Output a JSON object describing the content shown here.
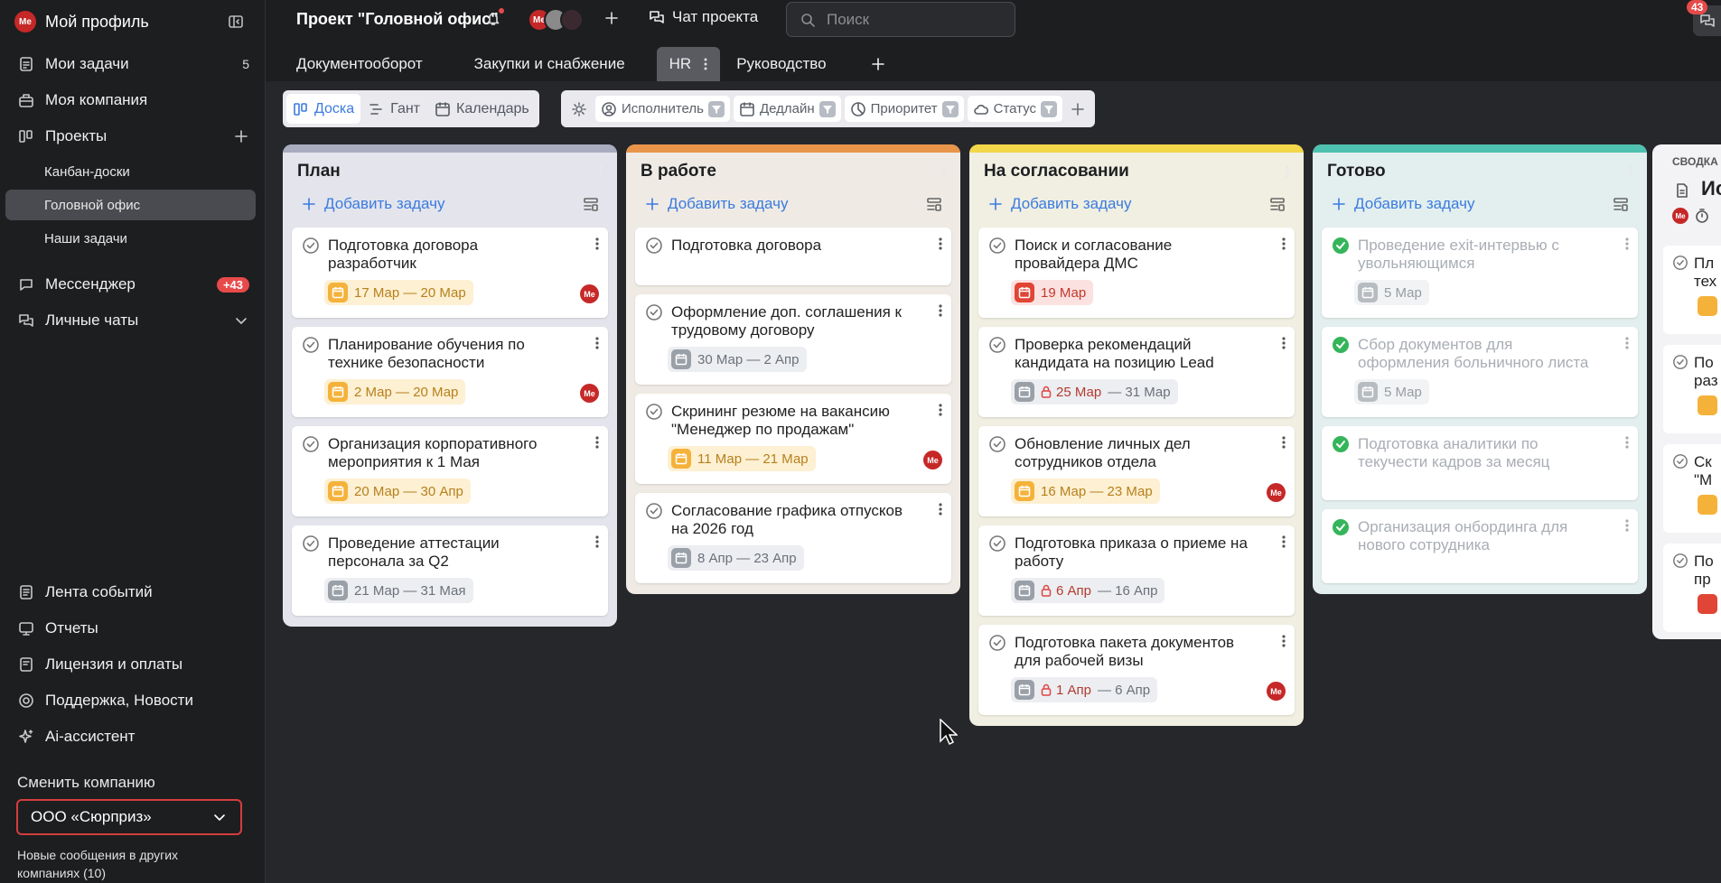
{
  "sidebar": {
    "profile": {
      "avatar": "Me",
      "label": "Мой профиль"
    },
    "items": [
      {
        "label": "Мои задачи",
        "icon": "tasks-icon",
        "count": "5"
      },
      {
        "label": "Моя компания",
        "icon": "company-icon"
      },
      {
        "label": "Проекты",
        "icon": "projects-icon"
      }
    ],
    "projects": [
      "Канбан-доски",
      "Головной офис",
      "Наши задачи"
    ],
    "messenger": {
      "label": "Мессенджер",
      "badge": "+43"
    },
    "personal_chats": "Личные чаты",
    "bottom": [
      "Лента событий",
      "Отчеты",
      "Лицензия и оплаты",
      "Поддержка, Новости",
      "Ai-ассистент"
    ],
    "switch_company_label": "Сменить компанию",
    "company": "ООО «Сюрприз»",
    "note": "Новые сообщения в других компаниях (10)"
  },
  "topbar": {
    "project_title": "Проект \"Головной офис\"",
    "avatar_me": "Me",
    "chat_label": "Чат проекта",
    "search_placeholder": "Поиск",
    "right_badge": "43"
  },
  "tabs": [
    "Документооборот",
    "Закупки и снабжение",
    "HR",
    "Руководство"
  ],
  "views": [
    "Доска",
    "Гант",
    "Календарь"
  ],
  "filters": [
    "Исполнитель",
    "Дедлайн",
    "Приоритет",
    "Статус"
  ],
  "colors": {
    "plan": "#a8acbf",
    "work": "#e8954a",
    "approve": "#f3d64a",
    "done": "#4fc1b0",
    "accent": "#3b7be0"
  },
  "columns": [
    {
      "title": "План",
      "add": "Добавить задачу",
      "cards": [
        {
          "title": "Подготовка договора разработчик",
          "date": "17 Мар — 20 Мар",
          "avatar": "Me"
        },
        {
          "title": "Планирование обучения по технике безопасности",
          "date": "2 Мар — 20 Мар",
          "avatar": "Me"
        },
        {
          "title": "Организация корпоративного мероприятия к 1 Мая",
          "date": "20 Мар — 30 Апр"
        },
        {
          "title": "Проведение аттестации персонала за Q2",
          "date": "21 Мар — 31 Мая"
        }
      ]
    },
    {
      "title": "В работе",
      "add": "Добавить задачу",
      "cards": [
        {
          "title": "Подготовка договора"
        },
        {
          "title": "Оформление доп. соглашения к трудовому договору",
          "date": "30 Мар — 2 Апр"
        },
        {
          "title": "Скрининг резюме на вакансию \"Менеджер по продажам\"",
          "date": "11 Мар — 21 Мар",
          "avatar": "Me"
        },
        {
          "title": "Согласование графика отпусков на 2026 год",
          "date": "8 Апр — 23 Апр"
        }
      ]
    },
    {
      "title": "На согласовании",
      "add": "Добавить задачу",
      "cards": [
        {
          "title": "Поиск и согласование провайдера ДМС",
          "date": "19 Мар"
        },
        {
          "title": "Проверка рекомендаций кандидата на позицию Lead",
          "date_start": "25 Мар",
          "date_end": "— 31 Мар"
        },
        {
          "title": "Обновление личных дел сотрудников отдела",
          "date": "16 Мар — 23 Мар",
          "avatar": "Me"
        },
        {
          "title": "Подготовка приказа о приеме на работу",
          "date_start": "6 Апр",
          "date_end": "— 16 Апр"
        },
        {
          "title": "Подготовка пакета документов для рабочей визы",
          "date_start": "1 Апр",
          "date_end": "— 6 Апр",
          "avatar": "Me"
        }
      ]
    },
    {
      "title": "Готово",
      "add": "Добавить задачу",
      "cards": [
        {
          "title": "Проведение exit-интервью с увольняющимся",
          "date": "5 Мар"
        },
        {
          "title": "Сбор документов для оформления больничного листа",
          "date": "5 Мар"
        },
        {
          "title": "Подготовка аналитики по текучести кадров за месяц"
        },
        {
          "title": "Организация онбординга для нового сотрудника"
        }
      ]
    }
  ],
  "summary": {
    "label": "СВОДКА",
    "title": "Ис",
    "avatar": "Me",
    "cards": [
      "Пл\nтех",
      "По\nраз",
      "Ск\n\"М",
      "По\nпр"
    ]
  }
}
